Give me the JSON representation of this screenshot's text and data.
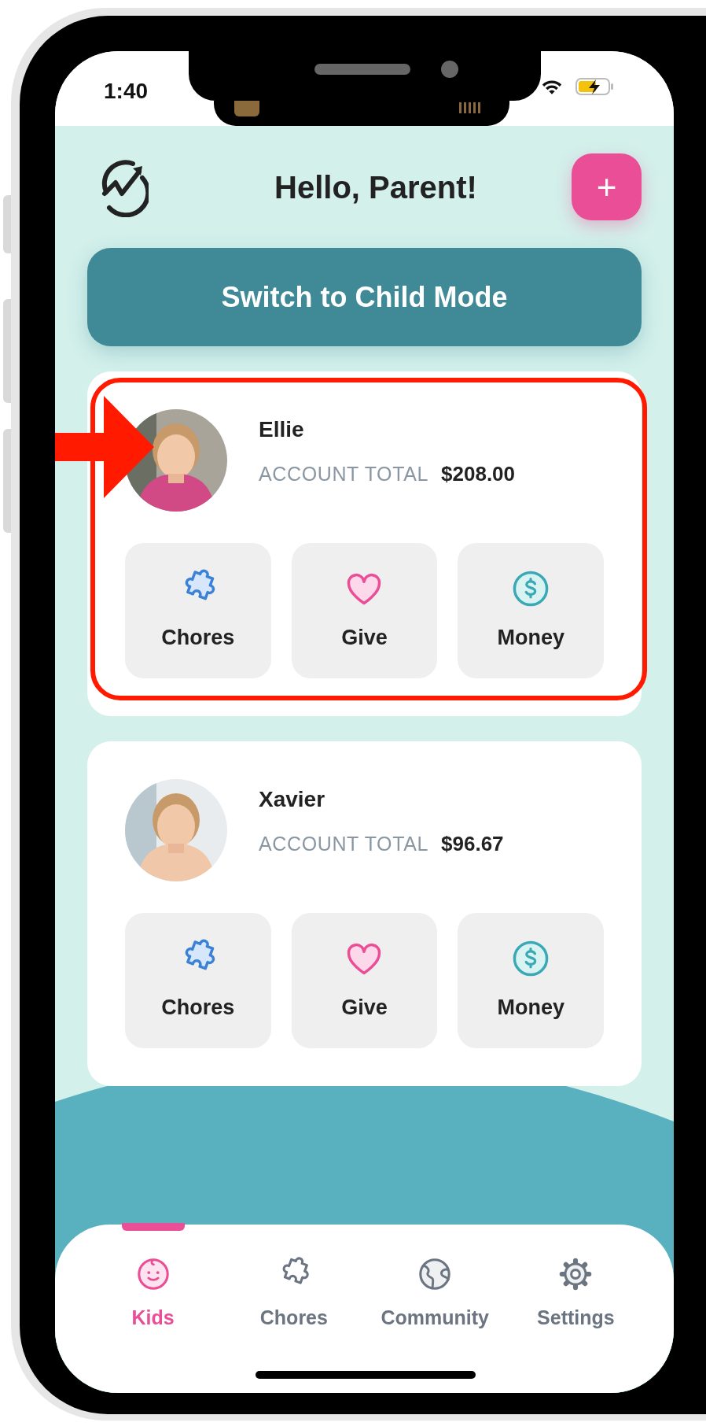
{
  "status_bar": {
    "time": "1:40"
  },
  "header": {
    "title": "Hello, Parent!",
    "add_button": "+"
  },
  "switch_button": {
    "label": "Switch to Child Mode"
  },
  "kids": [
    {
      "name": "Ellie",
      "total_label": "ACCOUNT TOTAL",
      "total": "$208.00",
      "highlighted": true,
      "actions": [
        {
          "kind": "chores",
          "label": "Chores"
        },
        {
          "kind": "give",
          "label": "Give"
        },
        {
          "kind": "money",
          "label": "Money"
        }
      ]
    },
    {
      "name": "Xavier",
      "total_label": "ACCOUNT TOTAL",
      "total": "$96.67",
      "highlighted": false,
      "actions": [
        {
          "kind": "chores",
          "label": "Chores"
        },
        {
          "kind": "give",
          "label": "Give"
        },
        {
          "kind": "money",
          "label": "Money"
        }
      ]
    }
  ],
  "tabs": [
    {
      "kind": "kids",
      "label": "Kids",
      "selected": true
    },
    {
      "kind": "chores",
      "label": "Chores",
      "selected": false
    },
    {
      "kind": "community",
      "label": "Community",
      "selected": false
    },
    {
      "kind": "settings",
      "label": "Settings",
      "selected": false
    }
  ]
}
